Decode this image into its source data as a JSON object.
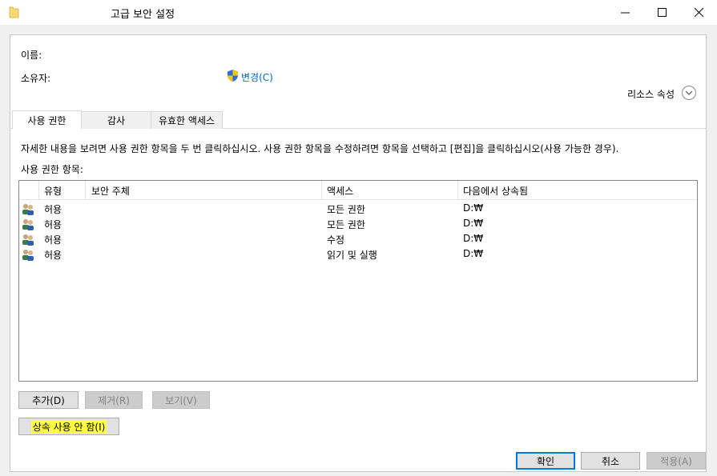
{
  "window": {
    "title": "고급 보안 설정",
    "minimize": "—",
    "maximize": "☐",
    "close": "✕"
  },
  "fields": {
    "name_label": "이름:",
    "owner_label": "소유자:",
    "change_link": "변경(C)",
    "resource_properties": "리소스 속성",
    "expand_icon": "chevron-down-icon"
  },
  "tabs": [
    {
      "label": "사용 권한",
      "active": true
    },
    {
      "label": "감사",
      "active": false
    },
    {
      "label": "유효한 액세스",
      "active": false
    }
  ],
  "info_text": "자세한 내용을 보려면 사용 권한 항목을 두 번 클릭하십시오. 사용 권한 항목을 수정하려면 항목을 선택하고 [편집]을 클릭하십시오(사용 가능한 경우).",
  "entries_label": "사용 권한 항목:",
  "table": {
    "columns": [
      "유형",
      "보안 주체",
      "액세스",
      "다음에서 상속됨"
    ],
    "rows": [
      {
        "type": "허용",
        "principal": "",
        "access": "모든 권한",
        "inherited": "D:₩"
      },
      {
        "type": "허용",
        "principal": "",
        "access": "모든 권한",
        "inherited": "D:₩"
      },
      {
        "type": "허용",
        "principal": "",
        "access": "수정",
        "inherited": "D:₩"
      },
      {
        "type": "허용",
        "principal": "",
        "access": "읽기 및 실행",
        "inherited": "D:₩"
      }
    ]
  },
  "buttons": {
    "add": "추가(D)",
    "remove": "제거(R)",
    "view": "보기(V)",
    "disable_inheritance": "상속 사용 안 함(I)",
    "ok": "확인",
    "cancel": "취소",
    "apply": "적용(A)"
  },
  "colors": {
    "link": "#0066cc",
    "highlight": "#ffff40",
    "default_button_border": "#0078d7"
  }
}
